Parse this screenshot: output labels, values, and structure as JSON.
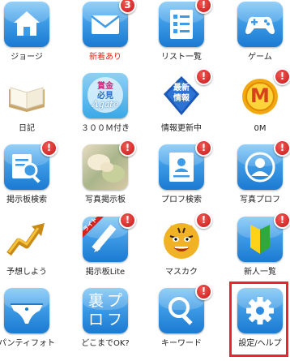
{
  "apps": [
    {
      "id": "george",
      "label": "ジョージ"
    },
    {
      "id": "new-mail",
      "label": "新着あり",
      "badge": "3"
    },
    {
      "id": "list",
      "label": "リスト一覧",
      "badge": "!"
    },
    {
      "id": "game",
      "label": "ゲーム"
    },
    {
      "id": "diary",
      "label": "日記"
    },
    {
      "id": "agate",
      "label": "３００Ｍ付き",
      "icon_text": [
        "賞金",
        "必見",
        "Agate"
      ]
    },
    {
      "id": "info",
      "label": "情報更新中",
      "badge": "!",
      "icon_text": [
        "最新",
        "情報"
      ]
    },
    {
      "id": "om",
      "label": "0M",
      "badge": "!",
      "icon_text": "M"
    },
    {
      "id": "board-search",
      "label": "掲示板検索",
      "badge": "!"
    },
    {
      "id": "photo-board",
      "label": "写真掲示板",
      "badge": "!"
    },
    {
      "id": "profile-search",
      "label": "プロフ検索",
      "badge": "!"
    },
    {
      "id": "photo-profile",
      "label": "写真プロフ",
      "badge": "!"
    },
    {
      "id": "forecast",
      "label": "予想しよう"
    },
    {
      "id": "board-lite",
      "label": "掲示板Lite",
      "badge": "!",
      "icon_text": "ライト"
    },
    {
      "id": "mascot",
      "label": "マスカク",
      "badge": "!"
    },
    {
      "id": "newcomer",
      "label": "新人一覧",
      "badge": "!"
    },
    {
      "id": "panty-photo",
      "label": "パンティフォト"
    },
    {
      "id": "how-far",
      "label": "どこまでOK?",
      "icon_text": [
        "裏",
        "プ",
        "ロ",
        "フ"
      ]
    },
    {
      "id": "keyword",
      "label": "キーワード",
      "badge": "!"
    },
    {
      "id": "settings",
      "label": "設定/ヘルプ"
    }
  ],
  "colors": {
    "tile_blue": "#2a8be0",
    "badge_red": "#d9211c",
    "highlight_red": "#e8262b",
    "new_label_red": "#e0261f"
  },
  "icons": [
    "house-icon",
    "envelope-icon",
    "checklist-icon",
    "gamepad-icon",
    "book-icon",
    "agate-icon",
    "newspaper-icon",
    "m-coin-icon",
    "magnifier-doc-icon",
    "photo-icon",
    "profile-card-icon",
    "person-icon",
    "rising-arrow-icon",
    "pencil-icon",
    "tiger-mascot-icon",
    "beginner-mark-icon",
    "panties-icon",
    "text-tile-icon",
    "search-icon",
    "gear-icon"
  ]
}
